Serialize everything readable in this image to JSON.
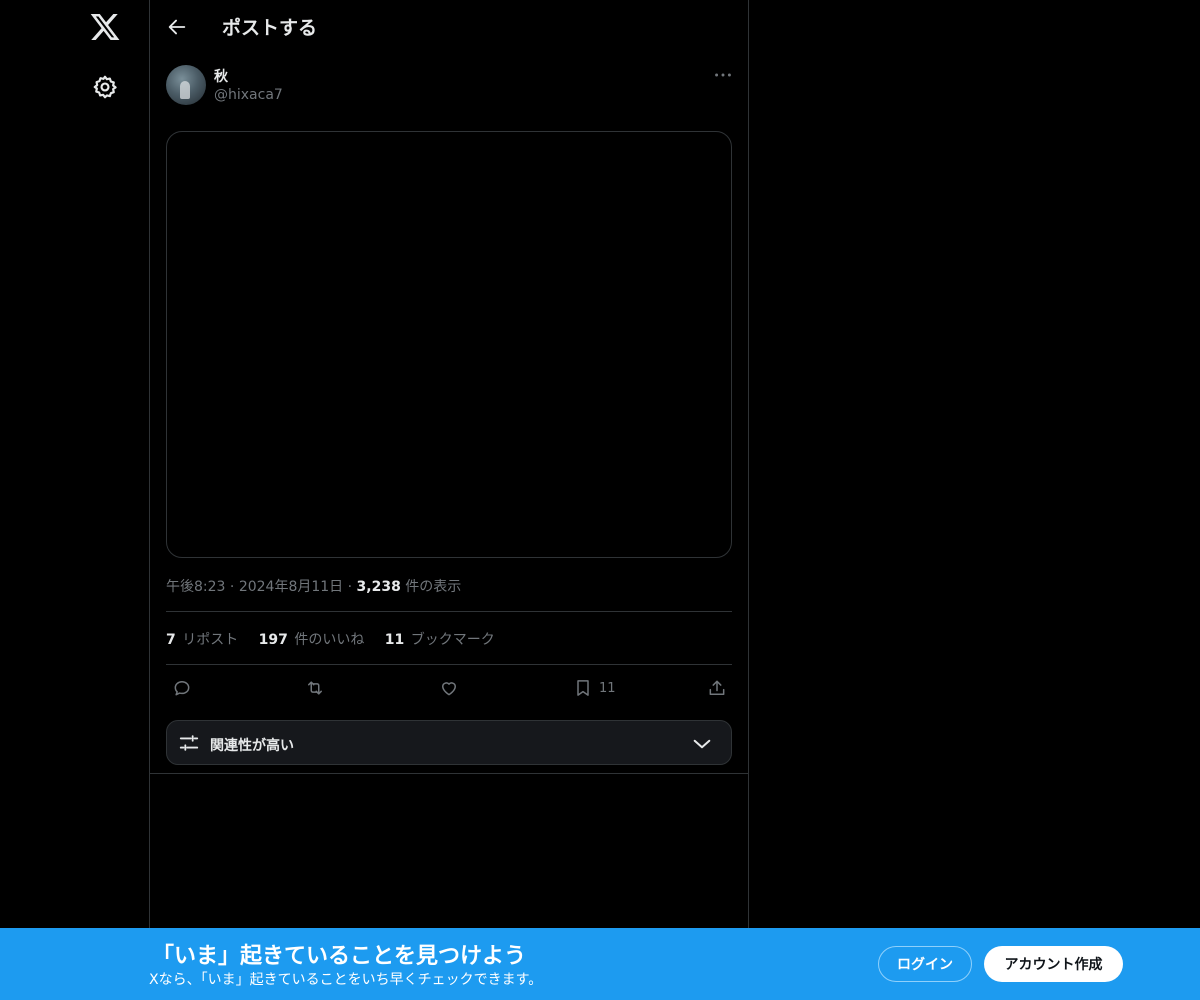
{
  "header": {
    "title": "ポストする"
  },
  "post": {
    "display_name": "秋",
    "handle": "@hixaca7",
    "time": "午後8:23",
    "date": "2024年8月11日",
    "views_count": "3,238",
    "views_label": "件の表示",
    "separator": "·"
  },
  "stats": {
    "reposts_count": "7",
    "reposts_label": "リポスト",
    "likes_count": "197",
    "likes_label": "件のいいね",
    "bookmarks_count": "11",
    "bookmarks_label": "ブックマーク"
  },
  "actions": {
    "bookmark_count": "11"
  },
  "sort": {
    "label": "関連性が高い"
  },
  "banner": {
    "title": "「いま」起きていることを見つけよう",
    "subtitle": "Xなら、「いま」起きていることをいち早くチェックできます。",
    "login_label": "ログイン",
    "signup_label": "アカウント作成"
  },
  "icons": {
    "logo": "x-logo-icon",
    "settings": "gear-icon",
    "back": "arrow-left-icon",
    "more": "more-horizontal-icon",
    "reply": "reply-icon",
    "repost": "repost-icon",
    "like": "heart-icon",
    "bookmark": "bookmark-icon",
    "share": "share-icon",
    "sort": "sliders-icon",
    "chevron": "chevron-down-icon"
  },
  "colors": {
    "background": "#000000",
    "text_primary": "#e7e9ea",
    "text_secondary": "#71767b",
    "border": "#2f3336",
    "banner": "#1d9bf0"
  }
}
